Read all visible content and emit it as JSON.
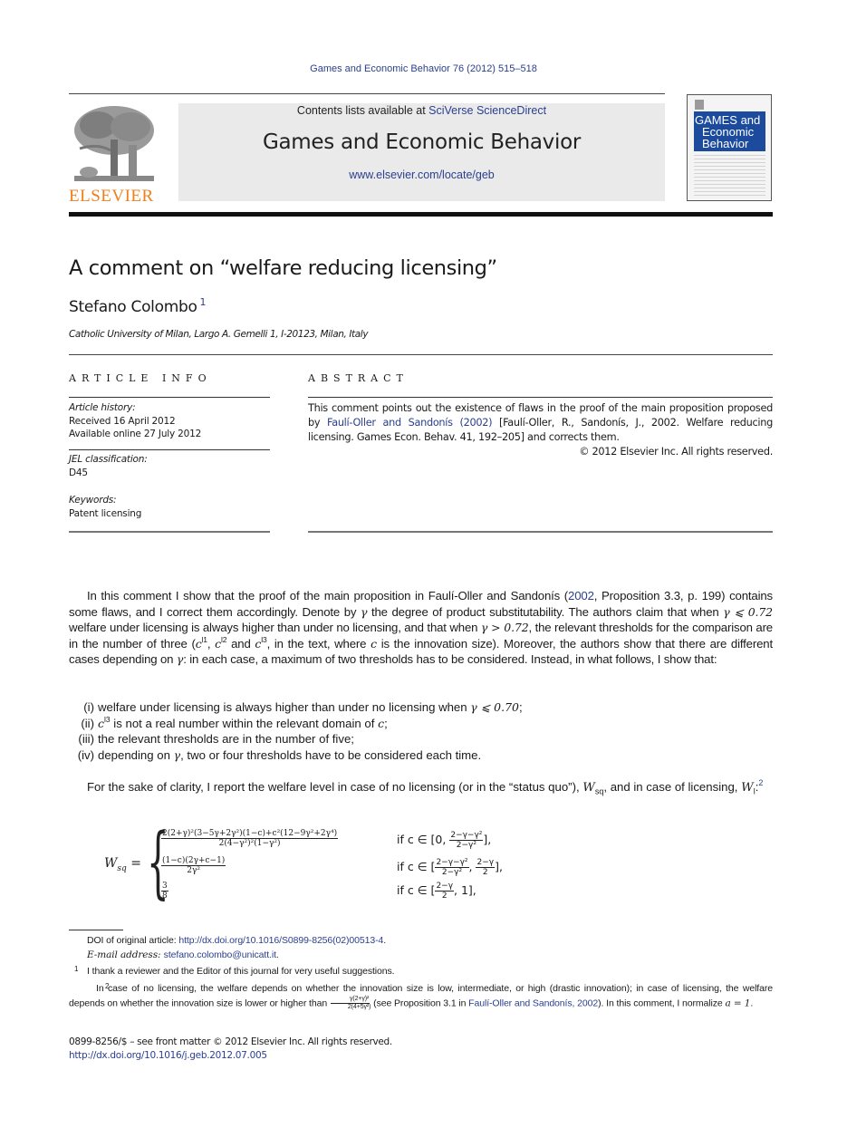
{
  "header": {
    "journal_ref": "Games and Economic Behavior 76 (2012) 515–518",
    "contents_prefix": "Contents lists available at ",
    "contents_link": "SciVerse ScienceDirect",
    "journal_title": "Games and Economic Behavior",
    "journal_url": "www.elsevier.com/locate/geb",
    "publisher_logo_text": "ELSEVIER",
    "cover": {
      "line1": "GAMES and",
      "line2": "Economic",
      "line3": "Behavior",
      "color": "#1c4a9c"
    },
    "logo_color": "#f07f1b",
    "link_color": "#2a3f8f"
  },
  "article": {
    "title": "A comment on “welfare reducing licensing”",
    "author": "Stefano Colombo",
    "author_footnote": "1",
    "affiliation": "Catholic University of Milan, Largo A. Gemelli 1, I-20123, Milan, Italy"
  },
  "article_info": {
    "heading": "ARTICLE INFO",
    "history_label": "Article history:",
    "received": "Received 16 April 2012",
    "available": "Available online 27 July 2012",
    "jel_label": "JEL classification:",
    "jel": "D45",
    "keywords_label": "Keywords:",
    "keywords": "Patent licensing"
  },
  "abstract": {
    "heading": "ABSTRACT",
    "text_before": "This comment points out the existence of flaws in the proof of the main proposition proposed by ",
    "cite": "Faulí-Oller and Sandonís (2002)",
    "text_after": " [Faulí-Oller, R., Sandonís, J., 2002. Welfare reducing licensing. Games Econ. Behav. 41, 192–205] and corrects them.",
    "copyright": "© 2012 Elsevier Inc. All rights reserved."
  },
  "body": {
    "p1": {
      "a": "In this comment I show that the proof of the main proposition in Faulí-Oller and Sandonís (",
      "cite_year": "2002",
      "b": ", Proposition 3.3, p. 199) contains some flaws, and I correct them accordingly. Denote by ",
      "gamma": "γ",
      "c": " the degree of product substitutability. The authors claim that when ",
      "leq": "γ ⩽ 0.72",
      "d": " welfare under licensing is always higher than under no licensing, and that when ",
      "gt": "γ > 0.72",
      "e": ", the relevant thresholds for the comparison are in the number of three (",
      "c_var": "c",
      "sup1": "l1",
      "sep1": ", ",
      "sup2": "l2",
      "and": " and ",
      "sup3": "l3",
      "f": ", in the text, where ",
      "g": " is the innovation size). Moreover, the authors show that there are different cases depending on ",
      "h": ": in each case, a maximum of two thresholds has to be considered. Instead, in what follows, I show that:"
    },
    "list": [
      {
        "num": "(i)",
        "text": "welfare under licensing is always higher than under no licensing when ",
        "math": "γ ⩽ 0.70",
        "end": ";"
      },
      {
        "num": "(ii)",
        "math_pre": "c",
        "sup": "l3",
        "text": " is not a real number within the relevant domain of ",
        "math": "c",
        "end": ";"
      },
      {
        "num": "(iii)",
        "text": "the relevant thresholds are in the number of five;"
      },
      {
        "num": "(iv)",
        "text": "depending on ",
        "math": "γ",
        "end": ", two or four thresholds have to be considered each time."
      }
    ],
    "p2": {
      "a": "For the sake of clarity, I report the welfare level in case of no licensing (or in the “status quo”), ",
      "wsq": "W",
      "wsq_sub": "sq",
      "b": ", and in case of licensing, ",
      "wl": "W",
      "wl_sub": "l",
      "c": ":",
      "fn": "2"
    }
  },
  "equation": {
    "lhs": "W",
    "lhs_sub": "sq",
    "eq": " =",
    "cases": [
      {
        "num": "2(2+γ)²(3−5γ+2γ²)(1−c)+c²(12−9γ²+2γ⁴)",
        "den": "2(4−γ²)²(1−γ²)",
        "cond_pre": "if c ∈ [0, ",
        "cond_num": "2−γ−γ²",
        "cond_den": "2−γ²",
        "cond_post": "],"
      },
      {
        "num": "(1−c)(2γ+c−1)",
        "den": "2γ²",
        "cond_pre": "if c ∈ [",
        "cond_num": "2−γ−γ²",
        "cond_den": "2−γ²",
        "cond_mid": ", ",
        "cond_num2": "2−γ",
        "cond_den2": "2",
        "cond_post": "],"
      },
      {
        "num": "3",
        "den": "8",
        "cond_pre": "if c ∈ [",
        "cond_num": "2−γ",
        "cond_den": "2",
        "cond_post": ", 1],"
      }
    ]
  },
  "footnotes": {
    "doi_label": "DOI of original article: ",
    "doi_link": "http://dx.doi.org/10.1016/S0899-8256(02)00513-4",
    "doi_end": ".",
    "email_label": "E-mail address: ",
    "email": "stefano.colombo@unicatt.it",
    "email_end": ".",
    "fn1_mark": "1",
    "fn1": "I thank a reviewer and the Editor of this journal for very useful suggestions.",
    "fn2_mark": "2",
    "fn2_a": "In case of no licensing, the welfare depends on whether the innovation size is low, intermediate, or high (drastic innovation); in case of licensing, the welfare depends on whether the innovation size is lower or higher than ",
    "fn2_frac_num": "γ(2+γ)²",
    "fn2_frac_den": "2(4+5γ²)",
    "fn2_b": " (see Proposition 3.1 in ",
    "fn2_cite": "Faulí-Oller and Sandonís, 2002",
    "fn2_c": "). In this comment, I normalize ",
    "fn2_math": "a = 1",
    "fn2_end": "."
  },
  "front_matter": {
    "issn_line": "0899-8256/$ – see front matter  © 2012 Elsevier Inc. All rights reserved.",
    "doi": "http://dx.doi.org/10.1016/j.geb.2012.07.005"
  }
}
